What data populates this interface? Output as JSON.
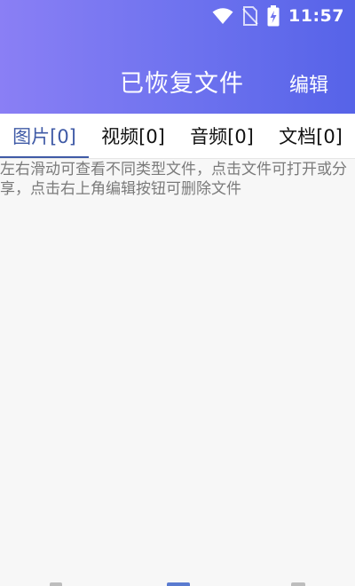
{
  "status_bar": {
    "time": "11:57",
    "icons": [
      "wifi-icon",
      "no-sim-icon",
      "battery-charging-icon"
    ]
  },
  "header": {
    "title": "已恢复文件",
    "edit_label": "编辑"
  },
  "tabs": [
    {
      "label": "图片[0]",
      "active": true
    },
    {
      "label": "视频[0]",
      "active": false
    },
    {
      "label": "音频[0]",
      "active": false
    },
    {
      "label": "文档[0]",
      "active": false
    }
  ],
  "hint_text": "左右滑动可查看不同类型文件，点击文件可打开或分享，点击右上角编辑按钮可删除文件",
  "colors": {
    "header_gradient_start": "#8a7ff5",
    "header_gradient_end": "#5663e8",
    "active_tab": "#3f5aa6",
    "hint_text": "#7a7a7a"
  }
}
